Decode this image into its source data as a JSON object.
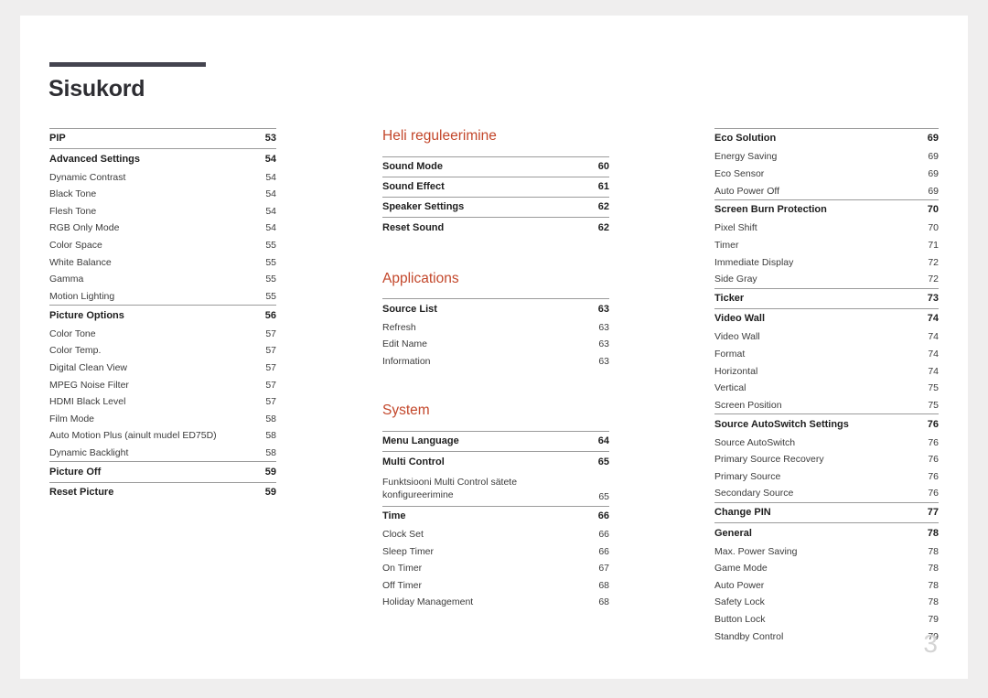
{
  "document": {
    "title": "Sisukord",
    "page_number": "3",
    "accent_color": "#c3472b",
    "title_rule_color": "#44444f"
  },
  "columns": [
    {
      "name": "column-1",
      "heading": null,
      "groups": [
        {
          "ruled": true,
          "entries": [
            {
              "label": "PIP",
              "page": "53",
              "level": "head"
            }
          ]
        },
        {
          "ruled": true,
          "entries": [
            {
              "label": "Advanced Settings",
              "page": "54",
              "level": "head"
            },
            {
              "label": "Dynamic Contrast",
              "page": "54",
              "level": "sub"
            },
            {
              "label": "Black Tone",
              "page": "54",
              "level": "sub"
            },
            {
              "label": "Flesh Tone",
              "page": "54",
              "level": "sub"
            },
            {
              "label": "RGB Only Mode",
              "page": "54",
              "level": "sub"
            },
            {
              "label": "Color Space",
              "page": "55",
              "level": "sub"
            },
            {
              "label": "White Balance",
              "page": "55",
              "level": "sub"
            },
            {
              "label": "Gamma",
              "page": "55",
              "level": "sub"
            },
            {
              "label": "Motion Lighting",
              "page": "55",
              "level": "sub"
            }
          ]
        },
        {
          "ruled": true,
          "entries": [
            {
              "label": "Picture Options",
              "page": "56",
              "level": "head"
            },
            {
              "label": "Color Tone",
              "page": "57",
              "level": "sub"
            },
            {
              "label": "Color Temp.",
              "page": "57",
              "level": "sub"
            },
            {
              "label": "Digital Clean View",
              "page": "57",
              "level": "sub"
            },
            {
              "label": "MPEG Noise Filter",
              "page": "57",
              "level": "sub"
            },
            {
              "label": "HDMI Black Level",
              "page": "57",
              "level": "sub"
            },
            {
              "label": "Film Mode",
              "page": "58",
              "level": "sub"
            },
            {
              "label": "Auto Motion Plus (ainult mudel ED75D)",
              "page": "58",
              "level": "sub"
            },
            {
              "label": "Dynamic Backlight",
              "page": "58",
              "level": "sub"
            }
          ]
        },
        {
          "ruled": true,
          "entries": [
            {
              "label": "Picture Off",
              "page": "59",
              "level": "head"
            }
          ]
        },
        {
          "ruled": true,
          "entries": [
            {
              "label": "Reset Picture",
              "page": "59",
              "level": "head"
            }
          ]
        }
      ]
    },
    {
      "name": "column-2",
      "sections": [
        {
          "heading": "Heli reguleerimine",
          "groups": [
            {
              "ruled": true,
              "entries": [
                {
                  "label": "Sound Mode",
                  "page": "60",
                  "level": "head"
                }
              ]
            },
            {
              "ruled": true,
              "entries": [
                {
                  "label": "Sound Effect",
                  "page": "61",
                  "level": "head"
                }
              ]
            },
            {
              "ruled": true,
              "entries": [
                {
                  "label": "Speaker Settings",
                  "page": "62",
                  "level": "head"
                }
              ]
            },
            {
              "ruled": true,
              "entries": [
                {
                  "label": "Reset Sound",
                  "page": "62",
                  "level": "head"
                }
              ]
            }
          ]
        },
        {
          "heading": "Applications",
          "groups": [
            {
              "ruled": true,
              "entries": [
                {
                  "label": "Source List",
                  "page": "63",
                  "level": "head"
                },
                {
                  "label": "Refresh",
                  "page": "63",
                  "level": "sub"
                },
                {
                  "label": "Edit Name",
                  "page": "63",
                  "level": "sub"
                },
                {
                  "label": "Information",
                  "page": "63",
                  "level": "sub"
                }
              ]
            }
          ]
        },
        {
          "heading": "System",
          "groups": [
            {
              "ruled": true,
              "entries": [
                {
                  "label": "Menu Language",
                  "page": "64",
                  "level": "head"
                }
              ]
            },
            {
              "ruled": true,
              "entries": [
                {
                  "label": "Multi Control",
                  "page": "65",
                  "level": "head"
                },
                {
                  "label": "Funktsiooni Multi Control sätete konfigureerimine",
                  "page": "65",
                  "level": "sub",
                  "multiline": true
                }
              ]
            },
            {
              "ruled": true,
              "entries": [
                {
                  "label": "Time",
                  "page": "66",
                  "level": "head"
                },
                {
                  "label": "Clock Set",
                  "page": "66",
                  "level": "sub"
                },
                {
                  "label": "Sleep Timer",
                  "page": "66",
                  "level": "sub"
                },
                {
                  "label": "On Timer",
                  "page": "67",
                  "level": "sub"
                },
                {
                  "label": "Off Timer",
                  "page": "68",
                  "level": "sub"
                },
                {
                  "label": "Holiday Management",
                  "page": "68",
                  "level": "sub"
                }
              ]
            }
          ]
        }
      ]
    },
    {
      "name": "column-3",
      "heading": null,
      "groups": [
        {
          "ruled": true,
          "entries": [
            {
              "label": "Eco Solution",
              "page": "69",
              "level": "head"
            },
            {
              "label": "Energy Saving",
              "page": "69",
              "level": "sub"
            },
            {
              "label": "Eco Sensor",
              "page": "69",
              "level": "sub"
            },
            {
              "label": "Auto Power Off",
              "page": "69",
              "level": "sub"
            }
          ]
        },
        {
          "ruled": true,
          "entries": [
            {
              "label": "Screen Burn Protection",
              "page": "70",
              "level": "head"
            },
            {
              "label": "Pixel Shift",
              "page": "70",
              "level": "sub"
            },
            {
              "label": "Timer",
              "page": "71",
              "level": "sub"
            },
            {
              "label": "Immediate Display",
              "page": "72",
              "level": "sub"
            },
            {
              "label": "Side Gray",
              "page": "72",
              "level": "sub"
            }
          ]
        },
        {
          "ruled": true,
          "entries": [
            {
              "label": "Ticker",
              "page": "73",
              "level": "head"
            }
          ]
        },
        {
          "ruled": true,
          "entries": [
            {
              "label": "Video Wall",
              "page": "74",
              "level": "head"
            },
            {
              "label": "Video Wall",
              "page": "74",
              "level": "sub"
            },
            {
              "label": "Format",
              "page": "74",
              "level": "sub"
            },
            {
              "label": "Horizontal",
              "page": "74",
              "level": "sub"
            },
            {
              "label": "Vertical",
              "page": "75",
              "level": "sub"
            },
            {
              "label": "Screen Position",
              "page": "75",
              "level": "sub"
            }
          ]
        },
        {
          "ruled": true,
          "entries": [
            {
              "label": "Source AutoSwitch Settings",
              "page": "76",
              "level": "head"
            },
            {
              "label": "Source AutoSwitch",
              "page": "76",
              "level": "sub"
            },
            {
              "label": "Primary Source Recovery",
              "page": "76",
              "level": "sub"
            },
            {
              "label": "Primary Source",
              "page": "76",
              "level": "sub"
            },
            {
              "label": "Secondary Source",
              "page": "76",
              "level": "sub"
            }
          ]
        },
        {
          "ruled": true,
          "entries": [
            {
              "label": "Change PIN",
              "page": "77",
              "level": "head"
            }
          ]
        },
        {
          "ruled": true,
          "entries": [
            {
              "label": "General",
              "page": "78",
              "level": "head"
            },
            {
              "label": "Max. Power Saving",
              "page": "78",
              "level": "sub"
            },
            {
              "label": "Game Mode",
              "page": "78",
              "level": "sub"
            },
            {
              "label": "Auto Power",
              "page": "78",
              "level": "sub"
            },
            {
              "label": "Safety Lock",
              "page": "78",
              "level": "sub"
            },
            {
              "label": "Button Lock",
              "page": "79",
              "level": "sub"
            },
            {
              "label": "Standby Control",
              "page": "79",
              "level": "sub"
            }
          ]
        }
      ]
    }
  ]
}
